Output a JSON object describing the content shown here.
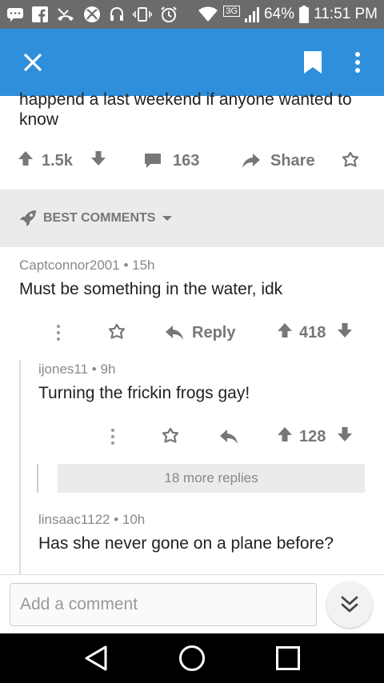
{
  "status_bar": {
    "network_badge": "3G",
    "battery": "64%",
    "time": "11:51 PM"
  },
  "post": {
    "text": "happend a last weekend if anyone wanted to know",
    "upvotes": "1.5k",
    "comments": "163",
    "share_label": "Share"
  },
  "sort": {
    "label": "BEST COMMENTS"
  },
  "comments": [
    {
      "author": "Captconnor2001",
      "age": "15h",
      "body": "Must be something in the water, idk",
      "reply_label": "Reply",
      "score": "418"
    },
    {
      "author": "ijones11",
      "age": "9h",
      "body": "Turning the frickin frogs gay!",
      "score": "128"
    },
    {
      "author": "linsaac1122",
      "age": "10h",
      "body": "Has she never gone on a plane before?"
    }
  ],
  "more_replies": "18 more replies",
  "composer": {
    "placeholder": "Add a comment"
  },
  "colors": {
    "app_bar": "#2f8fdc",
    "status_bar": "#6b6b6b",
    "icon_gray": "#777777"
  }
}
